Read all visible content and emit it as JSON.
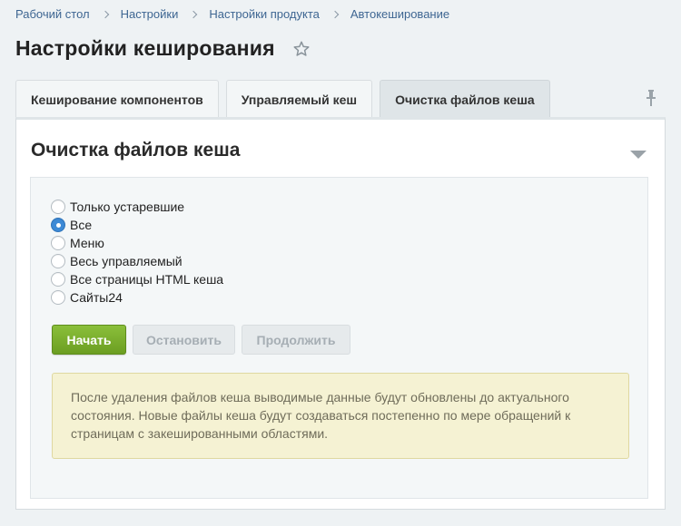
{
  "breadcrumb": [
    {
      "label": "Рабочий стол"
    },
    {
      "label": "Настройки"
    },
    {
      "label": "Настройки продукта"
    },
    {
      "label": "Автокеширование"
    }
  ],
  "page": {
    "title": "Настройки кеширования"
  },
  "tabs": [
    {
      "label": "Кеширование компонентов",
      "active": false
    },
    {
      "label": "Управляемый кеш",
      "active": false
    },
    {
      "label": "Очистка файлов кеша",
      "active": true
    }
  ],
  "panel": {
    "title": "Очистка файлов кеша"
  },
  "radio_options": [
    {
      "label": "Только устаревшие",
      "checked": false
    },
    {
      "label": "Все",
      "checked": true
    },
    {
      "label": "Меню",
      "checked": false
    },
    {
      "label": "Весь управляемый",
      "checked": false
    },
    {
      "label": "Все страницы HTML кеша",
      "checked": false
    },
    {
      "label": "Сайты24",
      "checked": false
    }
  ],
  "buttons": {
    "start": "Начать",
    "stop": "Остановить",
    "continue": "Продолжить"
  },
  "notice": {
    "text": "После удаления файлов кеша выводимые данные будут обновлены до актуального состояния. Новые файлы кеша будут создаваться постепенно по мере обращений к страницам с закешированными областями."
  },
  "colors": {
    "accent_blue": "#3d8ad6",
    "start_green": "#7aad2e",
    "notice_bg": "#f5f2d3",
    "link": "#3e6692"
  },
  "icons": {
    "favorite": "star-icon",
    "pin": "pin-icon",
    "collapse": "chevron-down-icon",
    "separator": "chevron-right-icon"
  }
}
